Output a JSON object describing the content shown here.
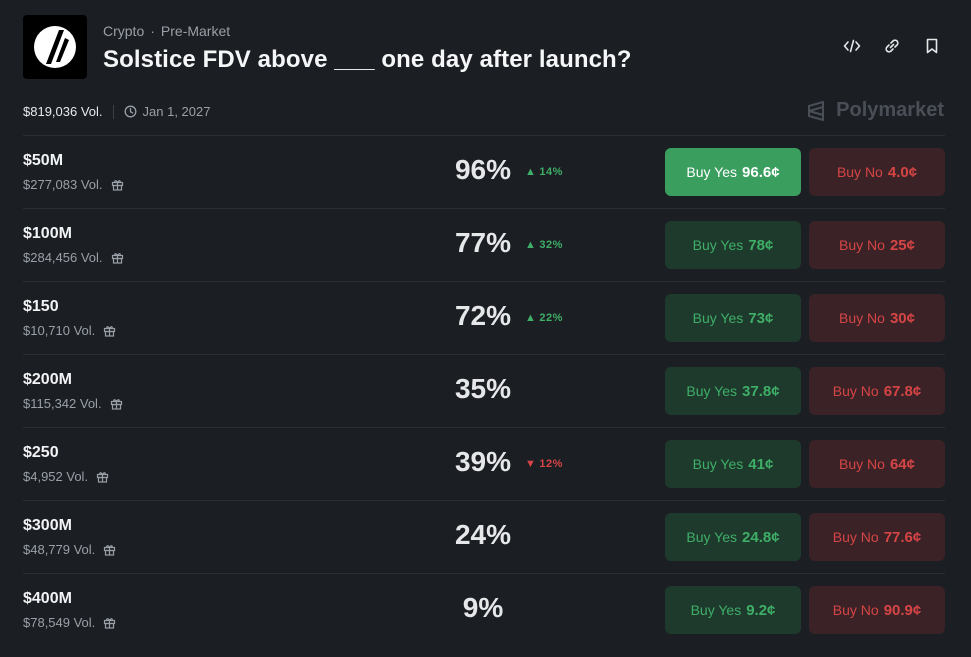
{
  "header": {
    "category": "Crypto",
    "subcategory": "Pre-Market",
    "title": "Solstice FDV above ___ one day after launch?"
  },
  "meta": {
    "volume": "$819,036 Vol.",
    "date": "Jan 1, 2027",
    "brand": "Polymarket"
  },
  "colors": {
    "yes": "#3fae67",
    "no": "#d64545",
    "background": "#1b1e23"
  },
  "rows": [
    {
      "name": "$50M",
      "volume": "$277,083 Vol.",
      "chance": "96%",
      "change": "14%",
      "direction": "up",
      "yes_label": "Buy Yes",
      "yes_price": "96.6¢",
      "no_label": "Buy No",
      "no_price": "4.0¢"
    },
    {
      "name": "$100M",
      "volume": "$284,456 Vol.",
      "chance": "77%",
      "change": "32%",
      "direction": "up",
      "yes_label": "Buy Yes",
      "yes_price": "78¢",
      "no_label": "Buy No",
      "no_price": "25¢"
    },
    {
      "name": "$150",
      "volume": "$10,710 Vol.",
      "chance": "72%",
      "change": "22%",
      "direction": "up",
      "yes_label": "Buy Yes",
      "yes_price": "73¢",
      "no_label": "Buy No",
      "no_price": "30¢"
    },
    {
      "name": "$200M",
      "volume": "$115,342 Vol.",
      "chance": "35%",
      "change": "",
      "direction": "none",
      "yes_label": "Buy Yes",
      "yes_price": "37.8¢",
      "no_label": "Buy No",
      "no_price": "67.8¢"
    },
    {
      "name": "$250",
      "volume": "$4,952 Vol.",
      "chance": "39%",
      "change": "12%",
      "direction": "down",
      "yes_label": "Buy Yes",
      "yes_price": "41¢",
      "no_label": "Buy No",
      "no_price": "64¢"
    },
    {
      "name": "$300M",
      "volume": "$48,779 Vol.",
      "chance": "24%",
      "change": "",
      "direction": "none",
      "yes_label": "Buy Yes",
      "yes_price": "24.8¢",
      "no_label": "Buy No",
      "no_price": "77.6¢"
    },
    {
      "name": "$400M",
      "volume": "$78,549 Vol.",
      "chance": "9%",
      "change": "",
      "direction": "none",
      "yes_label": "Buy Yes",
      "yes_price": "9.2¢",
      "no_label": "Buy No",
      "no_price": "90.9¢"
    }
  ]
}
